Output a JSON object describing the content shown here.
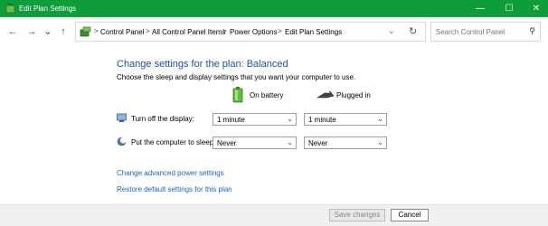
{
  "window": {
    "title": "Edit Plan Settings",
    "accent_color": "#0f9d3a",
    "controls": {
      "minimize": "—",
      "maximize": "☐",
      "close": "✕"
    }
  },
  "nav": {
    "back_icon": "←",
    "forward_icon": "→",
    "recent_icon": "⌄",
    "up_icon": "↑",
    "breadcrumb_sep": ">",
    "breadcrumbs": [
      "Control Panel",
      "All Control Panel Items",
      "Power Options",
      "Edit Plan Settings"
    ],
    "dropdown_icon": "⌄",
    "refresh_icon": "↻"
  },
  "search": {
    "placeholder": "Search Control Panel",
    "icon": "⚲"
  },
  "main": {
    "heading": "Change settings for the plan: Balanced",
    "subheading": "Choose the sleep and display settings that you want your computer to use.",
    "columns": {
      "battery": "On battery",
      "plugged": "Plugged in"
    },
    "rows": [
      {
        "label": "Turn off the display:",
        "battery_value": "1 minute",
        "plugged_value": "1 minute"
      },
      {
        "label": "Put the computer to sleep:",
        "battery_value": "Never",
        "plugged_value": "Never"
      }
    ],
    "links": {
      "advanced": "Change advanced power settings",
      "restore": "Restore default settings for this plan"
    }
  },
  "footer": {
    "save_label": "Save changes",
    "cancel_label": "Cancel"
  }
}
